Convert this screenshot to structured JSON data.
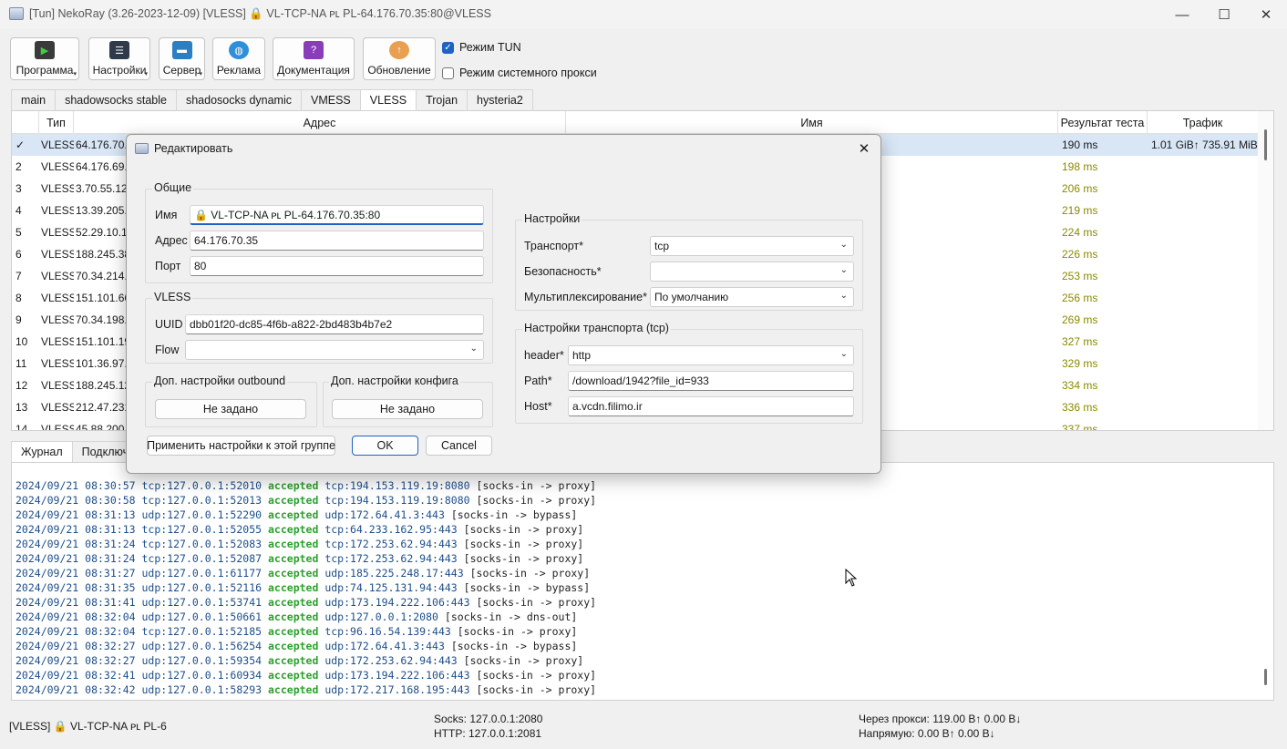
{
  "window": {
    "title": "[Tun] NekoRay (3.26-2023-12-09) [VLESS] 🔒 VL-TCP-NA ᴘʟ PL-64.176.70.35:80@VLESS",
    "minimize": "—",
    "maximize": "☐",
    "close": "✕"
  },
  "toolbar": {
    "buttons": [
      {
        "label": "Программа",
        "icon": "program-icon",
        "color": "#3a3a3a"
      },
      {
        "label": "Настройки",
        "icon": "settings-icon",
        "color": "#2f3a4a"
      },
      {
        "label": "Сервер",
        "icon": "server-icon",
        "color": "#2b7fc4"
      },
      {
        "label": "Реклама",
        "icon": "globe-icon",
        "color": "#2f8fd8"
      },
      {
        "label": "Документация",
        "icon": "help-icon",
        "color": "#8a3db8"
      },
      {
        "label": "Обновление",
        "icon": "update-icon",
        "color": "#e8a050"
      }
    ],
    "tun_mode": "Режим TUN",
    "system_proxy": "Режим системного прокси"
  },
  "group_tabs": [
    "main",
    "shadowsocks stable",
    "shadosocks dynamic",
    "VMESS",
    "VLESS",
    "Trojan",
    "hysteria2"
  ],
  "table": {
    "headers": {
      "type": "Тип",
      "address": "Адрес",
      "name": "Имя",
      "test": "Результат теста",
      "traffic": "Трафик"
    },
    "rows": [
      {
        "num": "✓",
        "type": "VLESS",
        "addr": "64.176.70.3",
        "test": "190 ms",
        "traffic": "1.01 GiB↑ 735.91 MiB↓"
      },
      {
        "num": "2",
        "type": "VLESS",
        "addr": "64.176.69.1",
        "test": "198 ms",
        "traffic": ""
      },
      {
        "num": "3",
        "type": "VLESS",
        "addr": "3.70.55.120",
        "test": "206 ms",
        "traffic": ""
      },
      {
        "num": "4",
        "type": "VLESS",
        "addr": "13.39.205.1",
        "test": "219 ms",
        "traffic": ""
      },
      {
        "num": "5",
        "type": "VLESS",
        "addr": "52.29.10.18",
        "test": "224 ms",
        "traffic": ""
      },
      {
        "num": "6",
        "type": "VLESS",
        "addr": "188.245.38.",
        "test": "226 ms",
        "traffic": ""
      },
      {
        "num": "7",
        "type": "VLESS",
        "addr": "70.34.214.1",
        "test": "253 ms",
        "traffic": ""
      },
      {
        "num": "8",
        "type": "VLESS",
        "addr": "151.101.66.",
        "test": "256 ms",
        "traffic": ""
      },
      {
        "num": "9",
        "type": "VLESS",
        "addr": "70.34.198.3",
        "test": "269 ms",
        "traffic": ""
      },
      {
        "num": "10",
        "type": "VLESS",
        "addr": "151.101.19.",
        "test": "327 ms",
        "traffic": ""
      },
      {
        "num": "11",
        "type": "VLESS",
        "addr": "101.36.97.2",
        "test": "329 ms",
        "traffic": ""
      },
      {
        "num": "12",
        "type": "VLESS",
        "addr": "188.245.12",
        "test": "334 ms",
        "traffic": ""
      },
      {
        "num": "13",
        "type": "VLESS",
        "addr": "212.47.231.",
        "test": "336 ms",
        "traffic": ""
      },
      {
        "num": "14",
        "type": "VLESS",
        "addr": "45.88.200.1",
        "test": "337 ms",
        "traffic": ""
      }
    ],
    "test_colors": {
      "first": "#1a1a1a",
      "others": "#8a8a00"
    }
  },
  "log_tabs": [
    "Журнал",
    "Подключ"
  ],
  "log": [
    {
      "ts": "2024/09/21 08:30:57",
      "src": "tcp:127.0.0.1:52010",
      "act": "accepted",
      "dst": "tcp:194.153.119.19:8080",
      "route": "[socks-in -> proxy]"
    },
    {
      "ts": "2024/09/21 08:30:58",
      "src": "tcp:127.0.0.1:52013",
      "act": "accepted",
      "dst": "tcp:194.153.119.19:8080",
      "route": "[socks-in -> proxy]"
    },
    {
      "ts": "2024/09/21 08:31:13",
      "src": "udp:127.0.0.1:52290",
      "act": "accepted",
      "dst": "udp:172.64.41.3:443",
      "route": "[socks-in -> bypass]"
    },
    {
      "ts": "2024/09/21 08:31:13",
      "src": "tcp:127.0.0.1:52055",
      "act": "accepted",
      "dst": "tcp:64.233.162.95:443",
      "route": "[socks-in -> proxy]"
    },
    {
      "ts": "2024/09/21 08:31:24",
      "src": "tcp:127.0.0.1:52083",
      "act": "accepted",
      "dst": "tcp:172.253.62.94:443",
      "route": "[socks-in -> proxy]"
    },
    {
      "ts": "2024/09/21 08:31:24",
      "src": "tcp:127.0.0.1:52087",
      "act": "accepted",
      "dst": "tcp:172.253.62.94:443",
      "route": "[socks-in -> proxy]"
    },
    {
      "ts": "2024/09/21 08:31:27",
      "src": "udp:127.0.0.1:61177",
      "act": "accepted",
      "dst": "udp:185.225.248.17:443",
      "route": "[socks-in -> proxy]"
    },
    {
      "ts": "2024/09/21 08:31:35",
      "src": "udp:127.0.0.1:52116",
      "act": "accepted",
      "dst": "udp:74.125.131.94:443",
      "route": "[socks-in -> bypass]"
    },
    {
      "ts": "2024/09/21 08:31:41",
      "src": "udp:127.0.0.1:53741",
      "act": "accepted",
      "dst": "udp:173.194.222.106:443",
      "route": "[socks-in -> proxy]"
    },
    {
      "ts": "2024/09/21 08:32:04",
      "src": "udp:127.0.0.1:50661",
      "act": "accepted",
      "dst": "udp:127.0.0.1:2080",
      "route": "[socks-in -> dns-out]"
    },
    {
      "ts": "2024/09/21 08:32:04",
      "src": "tcp:127.0.0.1:52185",
      "act": "accepted",
      "dst": "tcp:96.16.54.139:443",
      "route": "[socks-in -> proxy]"
    },
    {
      "ts": "2024/09/21 08:32:27",
      "src": "udp:127.0.0.1:56254",
      "act": "accepted",
      "dst": "udp:172.64.41.3:443",
      "route": "[socks-in -> bypass]"
    },
    {
      "ts": "2024/09/21 08:32:27",
      "src": "udp:127.0.0.1:59354",
      "act": "accepted",
      "dst": "udp:172.253.62.94:443",
      "route": "[socks-in -> proxy]"
    },
    {
      "ts": "2024/09/21 08:32:41",
      "src": "udp:127.0.0.1:60934",
      "act": "accepted",
      "dst": "udp:173.194.222.106:443",
      "route": "[socks-in -> proxy]"
    },
    {
      "ts": "2024/09/21 08:32:42",
      "src": "udp:127.0.0.1:58293",
      "act": "accepted",
      "dst": "udp:172.217.168.195:443",
      "route": "[socks-in -> proxy]"
    }
  ],
  "status": {
    "profile": "[VLESS] 🔒 VL-TCP-NA ᴘʟ PL-6",
    "socks": "Socks: 127.0.0.1:2080",
    "http": "HTTP: 127.0.0.1:2081",
    "proxy_traffic": "Через прокси: 119.00 B↑ 0.00 B↓",
    "direct_traffic": "Напрямую: 0.00 B↑ 0.00 B↓"
  },
  "dialog": {
    "title": "Редактировать",
    "close": "✕",
    "general": {
      "label": "Общие",
      "name_label": "Имя",
      "name_value": "🔒 VL-TCP-NA ᴘʟ PL-64.176.70.35:80",
      "address_label": "Адрес",
      "address_value": "64.176.70.35",
      "port_label": "Порт",
      "port_value": "80"
    },
    "vless": {
      "label": "VLESS",
      "uuid_label": "UUID",
      "uuid_value": "dbb01f20-dc85-4f6b-a822-2bd483b4b7e2",
      "flow_label": "Flow",
      "flow_value": ""
    },
    "outbound": {
      "label": "Доп. настройки outbound",
      "button": "Не задано"
    },
    "config": {
      "label": "Доп. настройки конфига",
      "button": "Не задано"
    },
    "settings": {
      "label": "Настройки",
      "transport_label": "Транспорт*",
      "transport_value": "tcp",
      "security_label": "Безопасность*",
      "security_value": "",
      "mux_label": "Мультиплексирование*",
      "mux_value": "По умолчанию"
    },
    "transport": {
      "label": "Настройки транспорта (tcp)",
      "header_label": "header*",
      "header_value": "http",
      "path_label": "Path*",
      "path_value": "/download/1942?file_id=933",
      "host_label": "Host*",
      "host_value": "a.vcdn.filimo.ir"
    },
    "apply_group": "Применить настройки к этой группе",
    "ok": "OK",
    "cancel": "Cancel"
  }
}
